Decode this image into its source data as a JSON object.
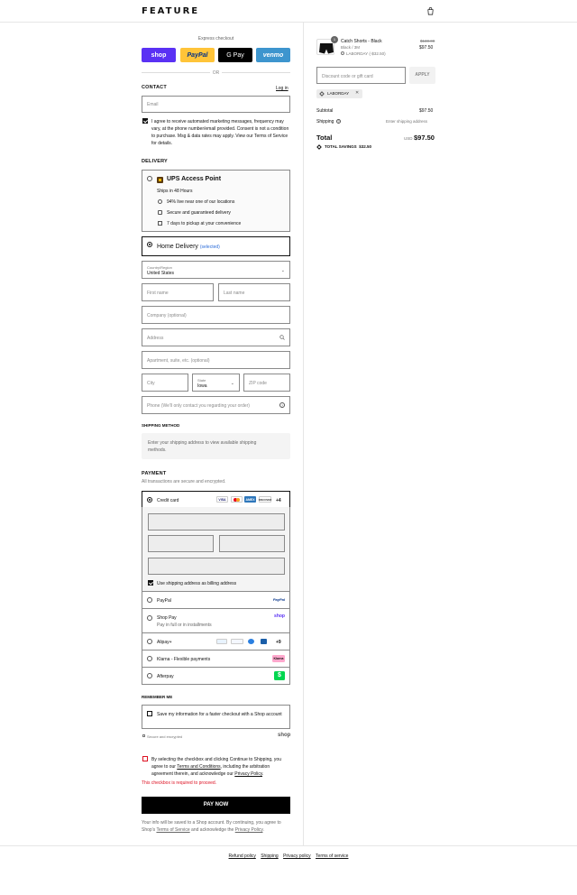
{
  "header": {
    "logo": "FEATURE",
    "cart_icon": "shopping-bag-icon"
  },
  "express": {
    "label": "Express checkout",
    "buttons": [
      {
        "label": "shop",
        "color": "#5a31f4"
      },
      {
        "label": "PayPal",
        "color": "#ffc439"
      },
      {
        "label": "G Pay",
        "color": "#000000"
      },
      {
        "label": "venmo",
        "color": "#3d95ce"
      }
    ],
    "or": "OR"
  },
  "contact": {
    "title": "CONTACT",
    "login": "Log in",
    "email_placeholder": "Email",
    "marketing_text": "I agree to receive automated marketing messages, frequency may vary, at the phone number/email provided. Consent is not a condition to purchase. Msg & data rates may apply. View our Terms of Service for details.",
    "marketing_checked": true
  },
  "delivery": {
    "title": "DELIVERY",
    "ups": {
      "label": "UPS Access Point",
      "ships": "Ships in 48 Hours",
      "features": [
        "94% live near one of our locations",
        "Secure and guaranteed delivery",
        "7 days to pickup at your convenience"
      ]
    },
    "home": {
      "label": "Home Delivery",
      "selected": "(selected)"
    },
    "country_label": "Country/Region",
    "country_value": "United States",
    "first_name": "First name",
    "last_name": "Last name",
    "company": "Company (optional)",
    "address": "Address",
    "apartment": "Apartment, suite, etc. (optional)",
    "city": "City",
    "state_label": "State",
    "state_value": "Iowa",
    "zip": "ZIP code",
    "phone": "Phone (We'll only contact you regarding your order)"
  },
  "shipping_method": {
    "title": "SHIPPING METHOD",
    "message": "Enter your shipping address to view available shipping methods."
  },
  "payment": {
    "title": "PAYMENT",
    "subtitle": "All transactions are secure and encrypted.",
    "credit_card": "Credit card",
    "card_logos": [
      "VISA",
      "MC",
      "AMEX",
      "DISCOVER"
    ],
    "more_cards": "+4",
    "billing_same": "Use shipping address as billing address",
    "paypal": "PayPal",
    "paypal_logo": "PayPal",
    "shoppay": "Shop Pay",
    "shoppay_sub": "Pay in full or in installments",
    "shoppay_logo": "shop",
    "alipay": "Alipay+",
    "alipay_more": "+9",
    "klarna": "Klarna - Flexible payments",
    "klarna_logo": "Klarna",
    "afterpay": "Afterpay"
  },
  "remember": {
    "title": "REMEMBER ME",
    "save_text": "Save my information for a faster checkout with a Shop account",
    "secure": "Secure and encrypted",
    "shop_logo": "shop"
  },
  "terms": {
    "text_before": "By selecting the checkbox and clicking Continue to Shipping, you agree to our ",
    "terms_link": "Terms and Conditions",
    "text_mid": ", including the arbitration agreement therein, and acknowledge our ",
    "privacy_link": "Privacy Policy",
    "text_end": ".",
    "error": "This checkbox is required to proceed."
  },
  "pay_now": "PAY NOW",
  "shop_notice": {
    "before": "Your info will be saved to a Shop account. By continuing, you agree to Shop's ",
    "tos": "Terms of Service",
    "mid": " and acknowledge the ",
    "privacy": "Privacy Policy",
    "end": "."
  },
  "summary": {
    "item": {
      "qty": "1",
      "name": "Catch Shorts - Black",
      "variant": "Black / 3M",
      "discount": "LABORDAY (-$32.50)",
      "original_price": "$130.00",
      "price": "$97.50"
    },
    "discount_placeholder": "Discount code or gift card",
    "apply": "APPLY",
    "applied_code": "LABORDAY",
    "subtotal_label": "Subtotal",
    "subtotal": "$97.50",
    "shipping_label": "Shipping",
    "shipping_value": "Enter shipping address",
    "total_label": "Total",
    "currency": "USD",
    "total": "$97.50",
    "savings_label": "TOTAL SAVINGS",
    "savings": "$32.50"
  },
  "footer": {
    "links": [
      "Refund policy",
      "Shipping",
      "Privacy policy",
      "Terms of service"
    ]
  }
}
